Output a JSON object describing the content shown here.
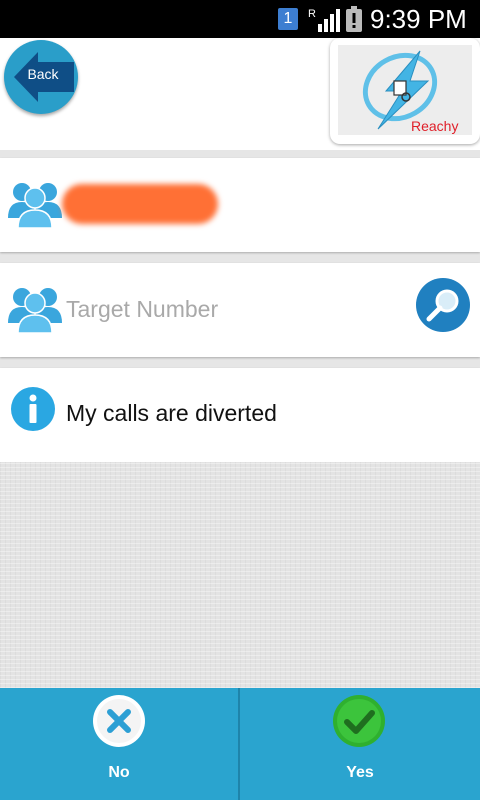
{
  "status_bar": {
    "notification_count": "1",
    "roaming_indicator": "R",
    "time": "9:39 PM",
    "icons": [
      "notification-icon",
      "signal-icon",
      "battery-alert-icon"
    ]
  },
  "header": {
    "back_label": "Back",
    "logo_text": "Reachy"
  },
  "contact_row": {
    "icon": "people-icon",
    "contact_name": ""
  },
  "target_row": {
    "icon": "people-icon",
    "placeholder": "Target Number",
    "value": "",
    "search_icon": "magnifier-icon"
  },
  "info_row": {
    "icon": "info-icon",
    "text": "My calls are diverted"
  },
  "bottom_bar": {
    "no_label": "No",
    "yes_label": "Yes",
    "no_icon": "close-icon",
    "yes_icon": "check-icon"
  },
  "colors": {
    "accent_blue": "#2aa4cf",
    "logo_red": "#e0202a",
    "redaction_orange": "#ff7035",
    "no_red": "#2c9fd4",
    "yes_green": "#3cc43c"
  }
}
